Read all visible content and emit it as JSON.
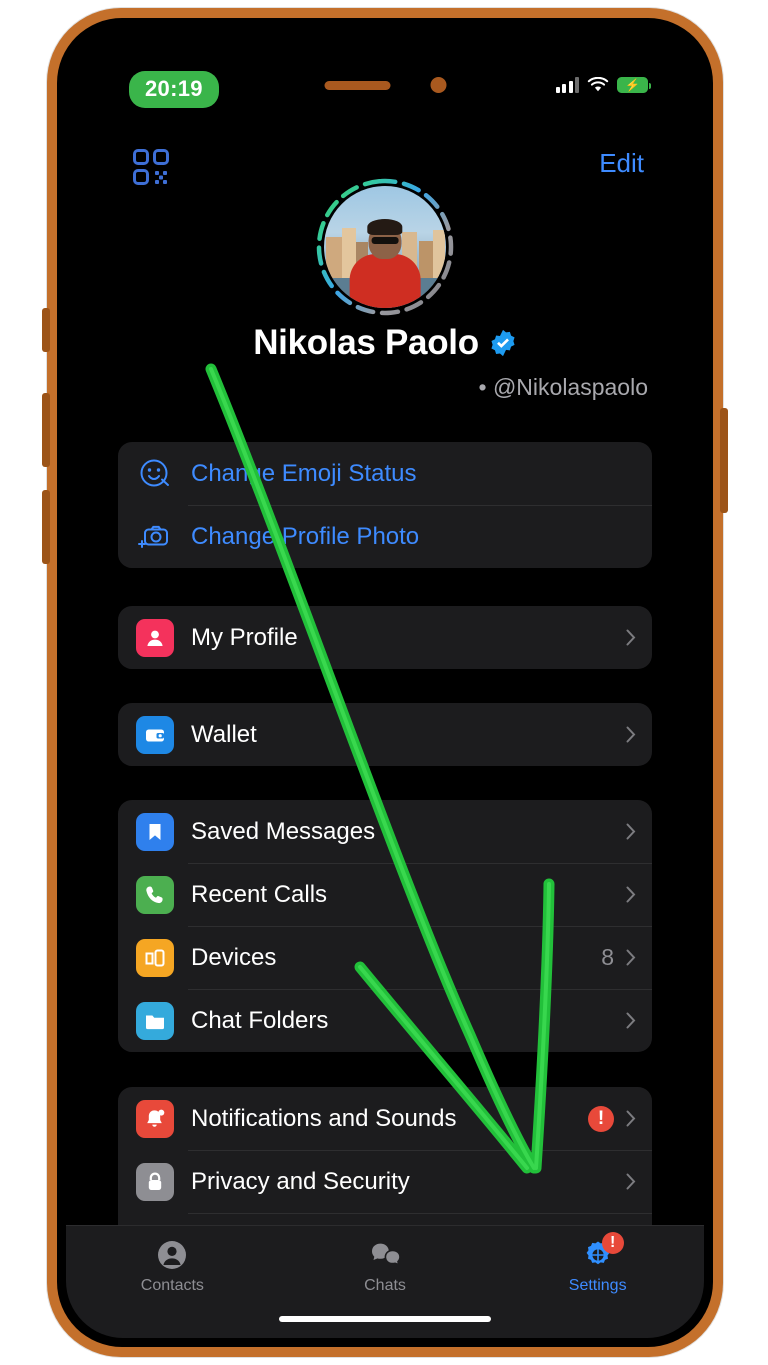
{
  "status_bar": {
    "time": "20:19",
    "signal_icon": "cellular-signal-icon",
    "wifi_icon": "wifi-icon",
    "battery_icon": "battery-charging-icon"
  },
  "nav": {
    "qr_icon": "qr-code-icon",
    "edit_label": "Edit"
  },
  "profile": {
    "avatar_icon": "profile-avatar",
    "name": "Nikolas Paolo",
    "verified_icon": "verified-badge-icon",
    "username": "• @Nikolaspaolo"
  },
  "sections": [
    {
      "name": "profile-actions",
      "rows": [
        {
          "label": "Change Emoji Status",
          "icon": "emoji-smiley-icon",
          "style": "blue",
          "value": "",
          "badge": "",
          "chevron": false
        },
        {
          "label": "Change Profile Photo",
          "icon": "camera-plus-icon",
          "style": "blue",
          "value": "",
          "badge": "",
          "chevron": false
        }
      ]
    },
    {
      "name": "my-profile",
      "rows": [
        {
          "label": "My Profile",
          "icon": "person-icon",
          "color": "#f4325c",
          "value": "",
          "badge": "",
          "chevron": true
        }
      ]
    },
    {
      "name": "wallet",
      "rows": [
        {
          "label": "Wallet",
          "icon": "wallet-icon",
          "color": "#1e88e5",
          "value": "",
          "badge": "",
          "chevron": true
        }
      ]
    },
    {
      "name": "main-list",
      "rows": [
        {
          "label": "Saved Messages",
          "icon": "bookmark-icon",
          "color": "#2f80ed",
          "value": "",
          "badge": "",
          "chevron": true
        },
        {
          "label": "Recent Calls",
          "icon": "phone-icon",
          "color": "#4caf50",
          "value": "",
          "badge": "",
          "chevron": true
        },
        {
          "label": "Devices",
          "icon": "devices-icon",
          "color": "#f5a623",
          "value": "8",
          "badge": "",
          "chevron": true
        },
        {
          "label": "Chat Folders",
          "icon": "folder-icon",
          "color": "#34aadc",
          "value": "",
          "badge": "",
          "chevron": true
        }
      ]
    },
    {
      "name": "settings-list",
      "rows": [
        {
          "label": "Notifications and Sounds",
          "icon": "bell-icon",
          "color": "#e8493a",
          "value": "",
          "badge": "!",
          "chevron": true
        },
        {
          "label": "Privacy and Security",
          "icon": "lock-icon",
          "color": "#8e8e93",
          "value": "",
          "badge": "",
          "chevron": true
        },
        {
          "label": "",
          "icon": "data-storage-icon",
          "color": "#3ab54a",
          "value": "",
          "badge": "",
          "chevron": false
        }
      ]
    }
  ],
  "tabs": [
    {
      "label": "Contacts",
      "icon": "contacts-person-icon",
      "active": false,
      "badge": ""
    },
    {
      "label": "Chats",
      "icon": "chats-bubbles-icon",
      "active": false,
      "badge": ""
    },
    {
      "label": "Settings",
      "icon": "settings-gear-icon",
      "active": true,
      "badge": "!"
    }
  ],
  "annotation": {
    "type": "hand-drawn-arrow",
    "color": "#22c03a"
  },
  "colors": {
    "accent_blue": "#3e8bff",
    "card_bg": "#1c1c1e",
    "screen_bg": "#000000",
    "frame": "#c4702b",
    "alert_red": "#e8493a",
    "annotation_green": "#22c03a"
  }
}
